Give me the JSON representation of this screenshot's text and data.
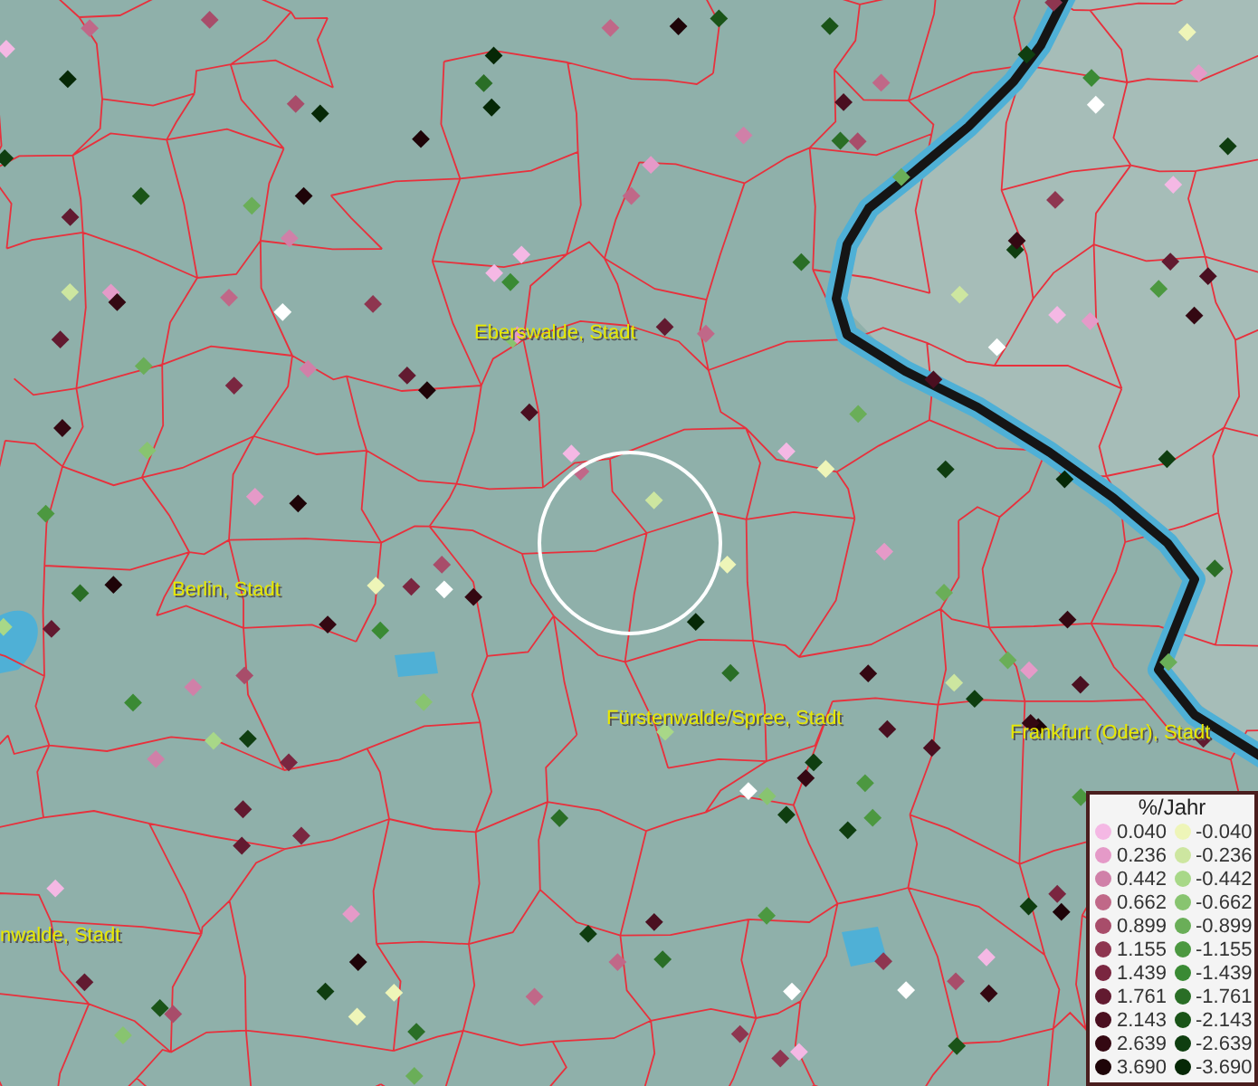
{
  "map": {
    "place_labels": [
      {
        "text": "Eberswalde, Stadt"
      },
      {
        "text": "Berlin, Stadt"
      },
      {
        "text": "Fürstenwalde/Spree, Stadt"
      },
      {
        "text": "Frankfurt (Oder), Stadt"
      },
      {
        "text": "nwalde, Stadt"
      }
    ]
  },
  "legend": {
    "title": "%/Jahr",
    "increase": [
      {
        "label": "0.040",
        "color": "#f4b8e4"
      },
      {
        "label": "0.236",
        "color": "#e59ac8"
      },
      {
        "label": "0.442",
        "color": "#d080a8"
      },
      {
        "label": "0.662",
        "color": "#c06888"
      },
      {
        "label": "0.899",
        "color": "#a84d6a"
      },
      {
        "label": "1.155",
        "color": "#8e3650"
      },
      {
        "label": "1.439",
        "color": "#7a2640"
      },
      {
        "label": "1.761",
        "color": "#621a30"
      },
      {
        "label": "2.143",
        "color": "#4a0f20"
      },
      {
        "label": "2.639",
        "color": "#340812"
      },
      {
        "label": "3.690",
        "color": "#1e0408"
      }
    ],
    "decrease": [
      {
        "label": "-0.040",
        "color": "#eef5b8"
      },
      {
        "label": "-0.236",
        "color": "#cde6a0"
      },
      {
        "label": "-0.442",
        "color": "#a8d888"
      },
      {
        "label": "-0.662",
        "color": "#88c470"
      },
      {
        "label": "-0.899",
        "color": "#6aae58"
      },
      {
        "label": "-1.155",
        "color": "#4c9840"
      },
      {
        "label": "-1.439",
        "color": "#3a8a34"
      },
      {
        "label": "-1.761",
        "color": "#2a6e26"
      },
      {
        "label": "-2.143",
        "color": "#1a5418"
      },
      {
        "label": "-2.639",
        "color": "#0f3e10"
      },
      {
        "label": "-3.690",
        "color": "#062806"
      }
    ]
  }
}
